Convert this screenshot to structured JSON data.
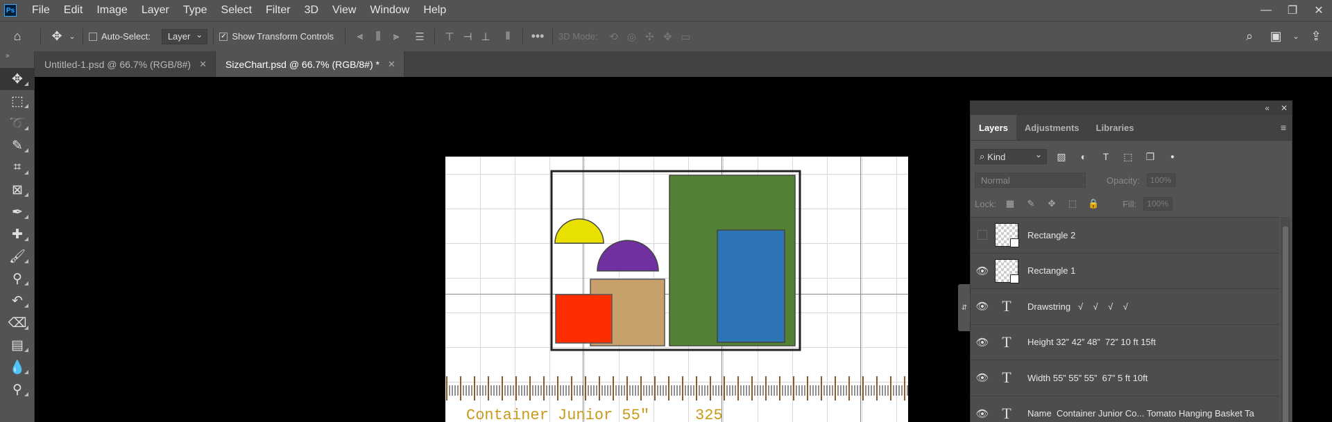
{
  "app": {
    "logo": "Ps"
  },
  "menu": [
    "File",
    "Edit",
    "Image",
    "Layer",
    "Type",
    "Select",
    "Filter",
    "3D",
    "View",
    "Window",
    "Help"
  ],
  "window_controls": {
    "minimize": "—",
    "restore": "❐",
    "close": "✕"
  },
  "options": {
    "auto_select_label": "Auto-Select:",
    "auto_select_value": "Layer",
    "show_transform_label": "Show Transform Controls",
    "mode_3d_label": "3D Mode:"
  },
  "tabs": [
    {
      "label": "Untitled-1.psd @ 66.7% (RGB/8#)",
      "active": false
    },
    {
      "label": "SizeChart.psd @ 66.7% (RGB/8#) *",
      "active": true
    }
  ],
  "tools": [
    "move-tool",
    "marquee-tool",
    "lasso-tool",
    "quick-select-tool",
    "crop-tool",
    "frame-tool",
    "eyedropper-tool",
    "healing-brush-tool",
    "brush-tool",
    "clone-stamp-tool",
    "history-brush-tool",
    "eraser-tool",
    "gradient-tool",
    "blur-tool",
    "dodge-tool"
  ],
  "canvas": {
    "bottom_text": "Container Junior 55\"     325",
    "colors": {
      "yellow": "#e8e000",
      "purple": "#7030a0",
      "tan": "#c8a06c",
      "red": "#ff2e00",
      "green": "#538135",
      "blue": "#2e75b6"
    }
  },
  "layers_panel": {
    "tabs": [
      "Layers",
      "Adjustments",
      "Libraries"
    ],
    "kind_label": "Kind",
    "blend_mode": "Normal",
    "opacity_label": "Opacity:",
    "opacity_value": "100%",
    "lock_label": "Lock:",
    "fill_label": "Fill:",
    "fill_value": "100%",
    "layers": [
      {
        "name": "Rectangle 2",
        "type": "shape",
        "visible": false
      },
      {
        "name": "Rectangle 1",
        "type": "shape",
        "visible": true
      },
      {
        "name": "Drawstring   √    √    √    √",
        "type": "text",
        "visible": true
      },
      {
        "name": "Height 32” 42” 48”  72” 10 ft 15ft",
        "type": "text",
        "visible": true
      },
      {
        "name": "Width 55” 55” 55”  67” 5 ft 10ft",
        "type": "text",
        "visible": true
      },
      {
        "name": "Name  Container Junior Co... Tomato Hanging Basket Ta",
        "type": "text",
        "visible": true
      }
    ]
  }
}
